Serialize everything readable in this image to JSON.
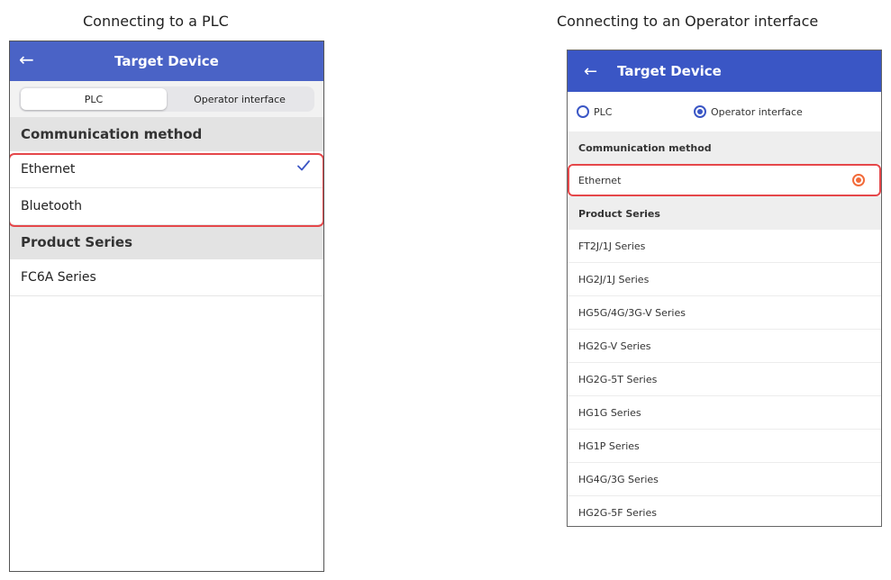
{
  "captions": {
    "left": "Connecting to a PLC",
    "right": "Connecting to an Operator interface"
  },
  "left_screen": {
    "title": "Target Device",
    "segments": [
      "PLC",
      "Operator interface"
    ],
    "selected_segment": "PLC",
    "comm_header": "Communication method",
    "comm_items": [
      "Ethernet",
      "Bluetooth"
    ],
    "selected_comm": "Ethernet",
    "series_header": "Product Series",
    "series_items": [
      "FC6A Series"
    ]
  },
  "right_screen": {
    "title": "Target Device",
    "radio_plc": "PLC",
    "radio_oi": "Operator interface",
    "selected_radio": "Operator interface",
    "comm_header": "Communication method",
    "comm_items": [
      "Ethernet"
    ],
    "selected_comm": "Ethernet",
    "series_header": "Product Series",
    "series_items": [
      "FT2J/1J Series",
      "HG2J/1J Series",
      "HG5G/4G/3G-V Series",
      "HG2G-V Series",
      "HG2G-5T Series",
      "HG1G Series",
      "HG1P Series",
      "HG4G/3G Series",
      "HG2G-5F Series"
    ]
  },
  "colors": {
    "ios_header": "#4a63c6",
    "android_header": "#3a56c5",
    "highlight": "#e5474a",
    "checkmark": "#3b55c4",
    "android_selected_radio": "#f26b3a"
  }
}
